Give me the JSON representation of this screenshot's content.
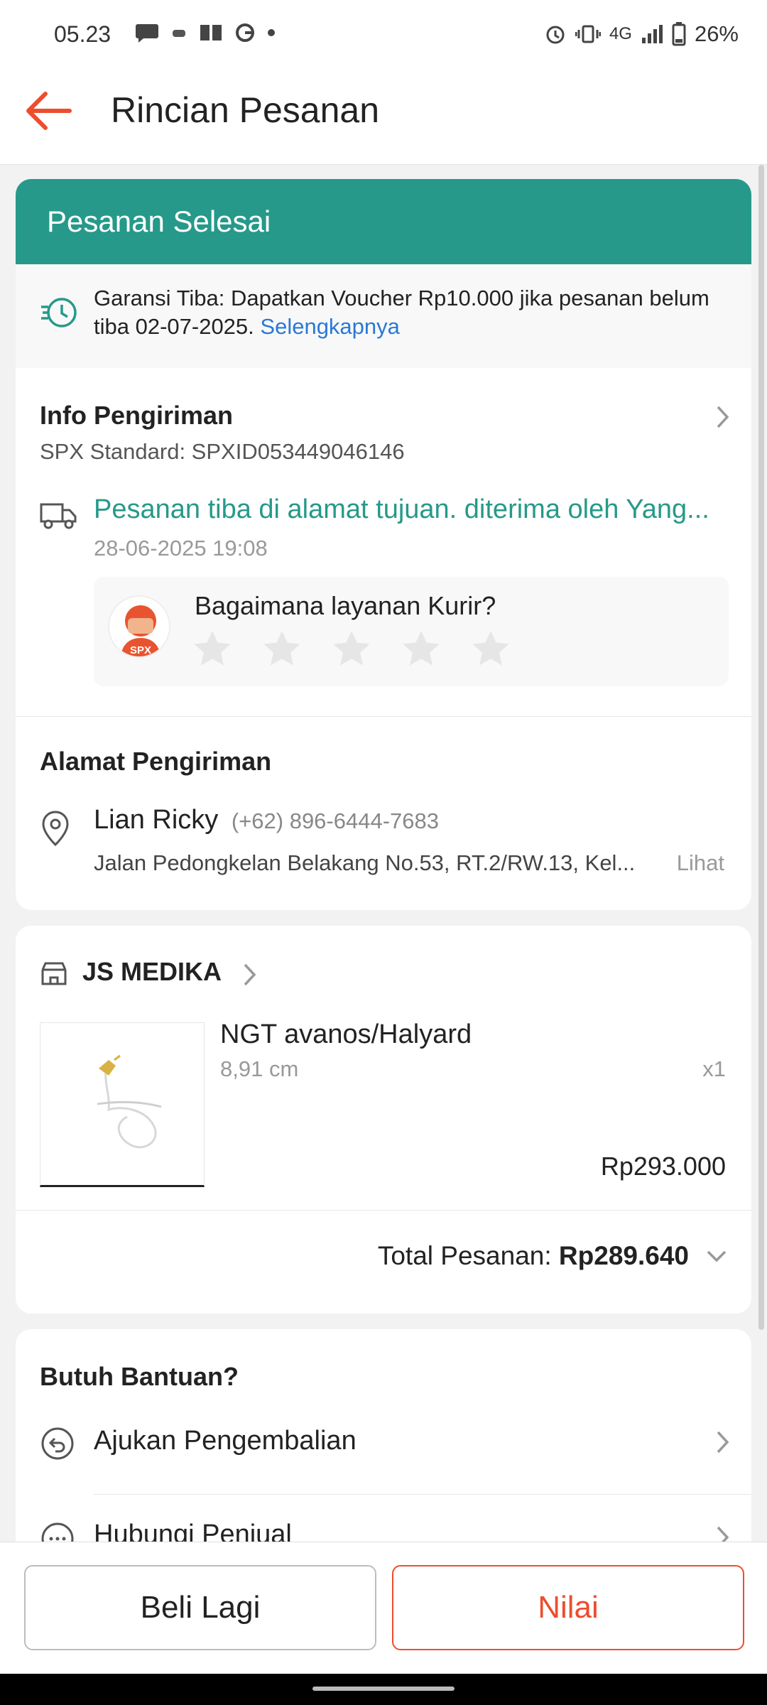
{
  "status_bar": {
    "time": "05.23",
    "network": "4G",
    "battery": "26%"
  },
  "app_bar": {
    "title": "Rincian Pesanan"
  },
  "order_status": {
    "label": "Pesanan Selesai",
    "color": "#26998a"
  },
  "guarantee": {
    "text": "Garansi Tiba: Dapatkan Voucher Rp10.000 jika pesanan belum tiba 02-07-2025.",
    "link": "Selengkapnya"
  },
  "shipping_info": {
    "heading": "Info Pengiriman",
    "service": "SPX Standard: SPXID053449046146",
    "tracking_status": "Pesanan tiba di alamat tujuan. diterima oleh Yang...",
    "tracking_time": "28-06-2025 19:08",
    "courier_question": "Bagaimana layanan Kurir?",
    "courier_logo_text": "SPX",
    "rating": 0,
    "max_rating": 5
  },
  "address": {
    "heading": "Alamat Pengiriman",
    "name": "Lian Ricky",
    "phone": "(+62) 896-6444-7683",
    "line": "Jalan Pedongkelan Belakang No.53, RT.2/RW.13, Kel...",
    "action": "Lihat"
  },
  "order": {
    "shop": "JS MEDIKA",
    "product_name": "NGT avanos/Halyard",
    "variant": "8,91 cm",
    "quantity": "x1",
    "price": "Rp293.000",
    "total_label": "Total Pesanan:",
    "total_value": "Rp289.640"
  },
  "help": {
    "heading": "Butuh Bantuan?",
    "items": [
      {
        "label": "Ajukan Pengembalian"
      },
      {
        "label": "Hubungi Penjual"
      }
    ]
  },
  "actions": {
    "buy_again": "Beli Lagi",
    "rate": "Nilai",
    "accent_color": "#ee4d2d"
  }
}
